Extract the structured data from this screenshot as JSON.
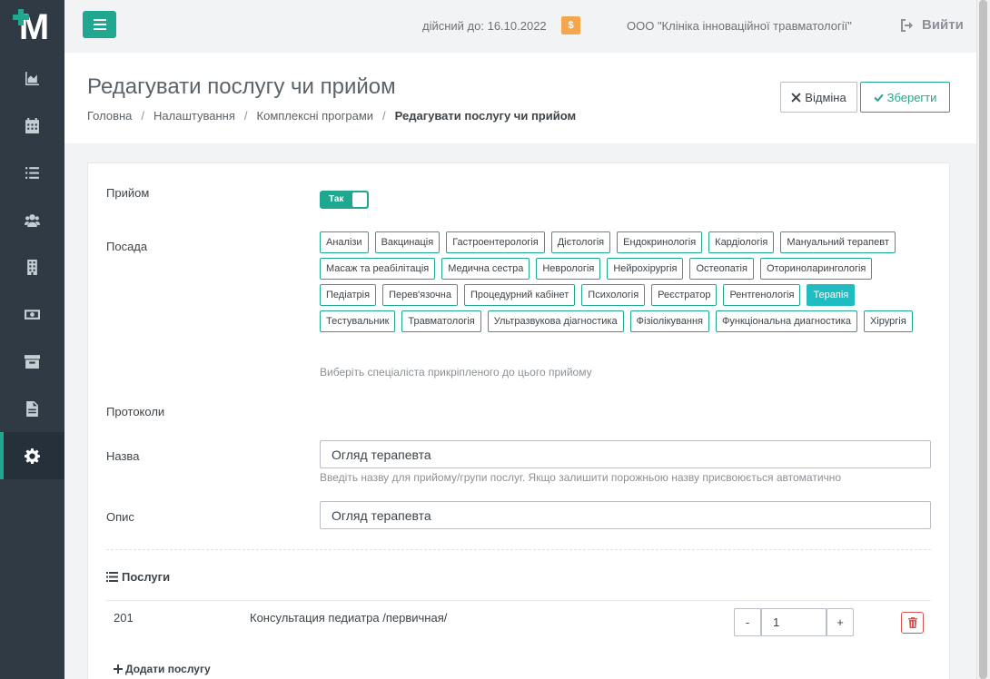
{
  "topbar": {
    "valid_until": "дійсний до: 16.10.2022",
    "coin_badge": "$",
    "org_name": "ООО \"Клініка інноваційної травматології\"",
    "logout_label": "Вийти"
  },
  "sidebar": {
    "logo_letter": "M",
    "items": [
      {
        "icon": "chart-area-icon"
      },
      {
        "icon": "calendar-icon"
      },
      {
        "icon": "list-icon"
      },
      {
        "icon": "users-icon"
      },
      {
        "icon": "building-icon"
      },
      {
        "icon": "money-icon"
      },
      {
        "icon": "archive-icon"
      },
      {
        "icon": "file-icon"
      },
      {
        "icon": "gear-icon",
        "active": true
      }
    ]
  },
  "header": {
    "title": "Редагувати послугу чи прийом",
    "breadcrumbs": [
      "Головна",
      "Налаштування",
      "Комплексні програми",
      "Редагувати послугу чи прийом"
    ],
    "cancel_label": "Відміна",
    "save_label": "Зберегти"
  },
  "form": {
    "reception_label": "Прийом",
    "toggle_label": "Так",
    "position_label": "Посада",
    "positions": [
      "Аналізи",
      "Вакцинація",
      "Гастроентерологія",
      "Дієтологія",
      "Ендокринологія",
      "Кардіологія",
      "Мануальний терапевт",
      "Масаж та реабілітація",
      "Медична сестра",
      "Неврологія",
      "Нейрохірургія",
      "Остеопатія",
      "Оториноларингологія",
      "Педіатрія",
      "Перев'язочна",
      "Процедурний кабінет",
      "Психологія",
      "Реєстратор",
      "Рентгенологія",
      "Терапія",
      "Тестувальник",
      "Травматологія",
      "Ультразвукова діагностика",
      "Фізіолікування",
      "Функціональна диагностика",
      "Хірургія"
    ],
    "selected_position": "Терапія",
    "position_help": "Виберіть спеціаліста прикріпленого до цього прийому",
    "protocols_label": "Протоколи",
    "name_label": "Назва",
    "name_value": "Огляд терапевта",
    "name_help": "Введіть назву для прийому/групи послуг. Якщо залишити порожньою назву присвоюється автоматично",
    "description_label": "Опис",
    "description_value": "Огляд терапевта"
  },
  "services": {
    "heading": "Послуги",
    "rows": [
      {
        "code": "201",
        "name": "Консультация педиатра /первичная/",
        "quantity": "1"
      }
    ],
    "minus_label": "-",
    "plus_label": "+",
    "add_label": "Додати послугу"
  },
  "colors": {
    "accent": "#1fa88f",
    "selected_tag": "#1fbcc2",
    "sidebar": "#2f3a44",
    "danger": "#d9534f",
    "coin": "#f3a64c"
  }
}
